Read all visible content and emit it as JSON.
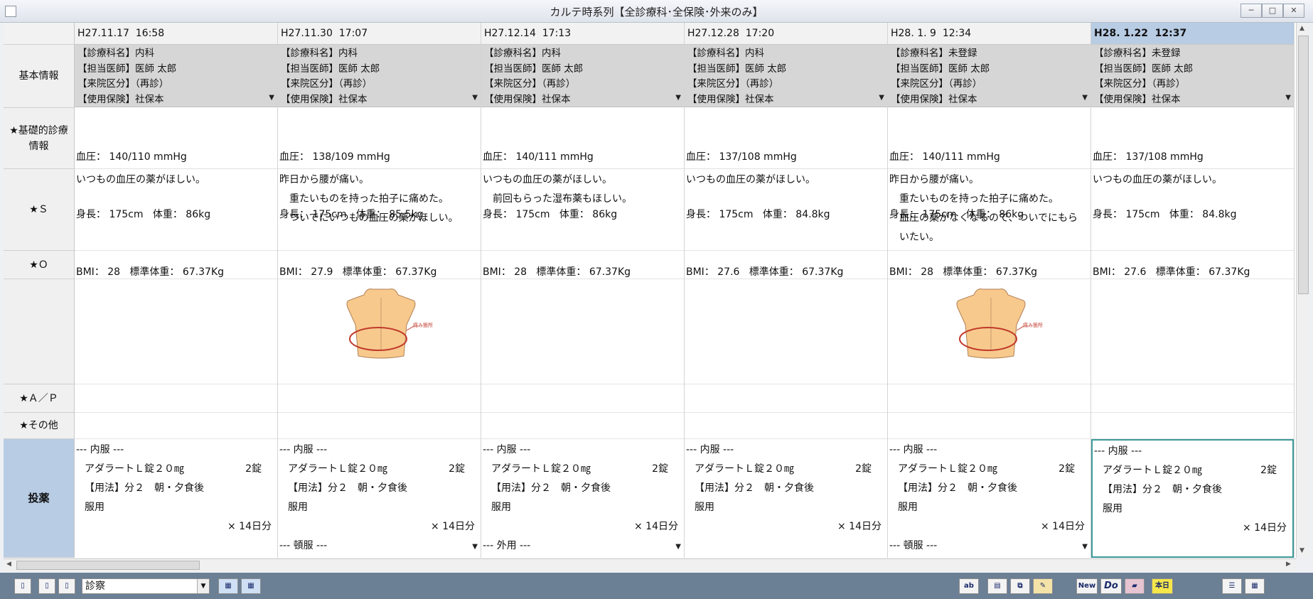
{
  "window": {
    "title": "カルテ時系列【全診療科･全保険･外来のみ】"
  },
  "row_headers": {
    "basic": "基本情報",
    "vitals_line1": "★基礎的診療",
    "vitals_line2": "情報",
    "s": "★Ｓ",
    "o": "★Ｏ",
    "ap": "★Ａ／Ｐ",
    "other": "★その他",
    "drug": "投薬"
  },
  "columns": [
    {
      "date": "H27.11.17  16:58",
      "dept": "【診療科名】内科",
      "doctor": "【担当医師】医師 太郎",
      "visit": "【来院区分】（再診）",
      "insurance": "【使用保険】社保本",
      "bp": "血圧： 140/110 mmHg",
      "hw": "身長： 175cm   体重： 86kg",
      "bmi": "BMI： 28   標準体重： 67.37Kg",
      "s_lines": [
        "いつもの血圧の薬がほしい。"
      ],
      "figure": false,
      "med_header": "--- 内服 ---",
      "med_name": "アダラートＬ錠２０㎎",
      "med_qty": "2錠",
      "med_usage": "【用法】分２　朝・夕食後",
      "med_take": "服用",
      "med_days": "× 14日分",
      "med_extra": ""
    },
    {
      "date": "H27.11.30  17:07",
      "dept": "【診療科名】内科",
      "doctor": "【担当医師】医師 太郎",
      "visit": "【来院区分】（再診）",
      "insurance": "【使用保険】社保本",
      "bp": "血圧： 138/109 mmHg",
      "hw": "身長： 175cm   体重： 85.5kg",
      "bmi": "BMI： 27.9   標準体重： 67.37Kg",
      "s_lines": [
        "昨日から腰が痛い。",
        "　重たいものを持った拍子に痛めた。",
        "　ついでにいつもの血圧の薬がほしい。"
      ],
      "figure": true,
      "figure_label": "痛み箇所",
      "med_header": "--- 内服 ---",
      "med_name": "アダラートＬ錠２０㎎",
      "med_qty": "2錠",
      "med_usage": "【用法】分２　朝・夕食後",
      "med_take": "服用",
      "med_days": "× 14日分",
      "med_extra": "--- 頓服 ---"
    },
    {
      "date": "H27.12.14  17:13",
      "dept": "【診療科名】内科",
      "doctor": "【担当医師】医師 太郎",
      "visit": "【来院区分】（再診）",
      "insurance": "【使用保険】社保本",
      "bp": "血圧： 140/111 mmHg",
      "hw": "身長： 175cm   体重： 86kg",
      "bmi": "BMI： 28   標準体重： 67.37Kg",
      "s_lines": [
        "いつもの血圧の薬がほしい。",
        "　前回もらった湿布薬もほしい。"
      ],
      "figure": false,
      "med_header": "--- 内服 ---",
      "med_name": "アダラートＬ錠２０㎎",
      "med_qty": "2錠",
      "med_usage": "【用法】分２　朝・夕食後",
      "med_take": "服用",
      "med_days": "× 14日分",
      "med_extra": "--- 外用 ---"
    },
    {
      "date": "H27.12.28  17:20",
      "dept": "【診療科名】内科",
      "doctor": "【担当医師】医師 太郎",
      "visit": "【来院区分】（再診）",
      "insurance": "【使用保険】社保本",
      "bp": "血圧： 137/108 mmHg",
      "hw": "身長： 175cm   体重： 84.8kg",
      "bmi": "BMI： 27.6   標準体重： 67.37Kg",
      "s_lines": [
        "いつもの血圧の薬がほしい。"
      ],
      "figure": false,
      "med_header": "--- 内服 ---",
      "med_name": "アダラートＬ錠２０㎎",
      "med_qty": "2錠",
      "med_usage": "【用法】分２　朝・夕食後",
      "med_take": "服用",
      "med_days": "× 14日分",
      "med_extra": ""
    },
    {
      "date": "H28. 1. 9  12:34",
      "dept": "【診療科名】未登録",
      "doctor": "【担当医師】医師 太郎",
      "visit": "【来院区分】（再診）",
      "insurance": "【使用保険】社保本",
      "bp": "血圧： 140/111 mmHg",
      "hw": "身長： 175cm   体重： 86kg",
      "bmi": "BMI： 28   標準体重： 67.37Kg",
      "s_lines": [
        "昨日から腰が痛い。",
        "　重たいものを持った拍子に痛めた。",
        "　血圧の薬がなくなるので、ついでにもら",
        "　いたい。"
      ],
      "figure": true,
      "figure_label": "痛み箇所",
      "med_header": "--- 内服 ---",
      "med_name": "アダラートＬ錠２０㎎",
      "med_qty": "2錠",
      "med_usage": "【用法】分２　朝・夕食後",
      "med_take": "服用",
      "med_days": "× 14日分",
      "med_extra": "--- 頓服 ---"
    },
    {
      "date": "H28. 1.22  12:37",
      "dept": "【診療科名】未登録",
      "doctor": "【担当医師】医師 太郎",
      "visit": "【来院区分】（再診）",
      "insurance": "【使用保険】社保本",
      "bp": "血圧： 137/108 mmHg",
      "hw": "身長： 175cm   体重： 84.8kg",
      "bmi": "BMI： 27.6   標準体重： 67.37Kg",
      "s_lines": [
        "いつもの血圧の薬がほしい。"
      ],
      "figure": false,
      "med_header": "--- 内服 ---",
      "med_name": "アダラートＬ錠２０㎎",
      "med_qty": "2錠",
      "med_usage": "【用法】分２　朝・夕食後",
      "med_take": "服用",
      "med_days": "× 14日分",
      "med_extra": ""
    }
  ],
  "selected_column": 5,
  "toolbar": {
    "mode_select_value": "診察",
    "btn_ab": "ab",
    "btn_new": "New",
    "btn_do": "Do",
    "btn_today": "本日"
  },
  "colors": {
    "selected_header": "#b8cce4",
    "basic_bg": "#d6d6d6",
    "toolbar_bg": "#6b7f95",
    "figure_circle": "#c0392b",
    "figure_skin": "#f7c98d"
  }
}
